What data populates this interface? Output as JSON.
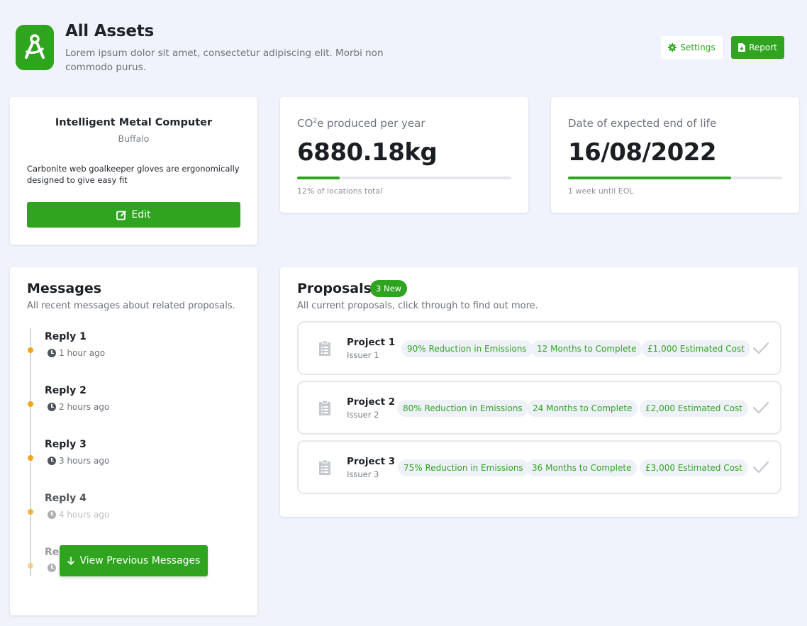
{
  "header": {
    "title": "All Assets",
    "subtitle": "Lorem ipsum dolor sit amet, consectetur adipiscing elit. Morbi non commodo purus.",
    "settings_label": "Settings",
    "report_label": "Report"
  },
  "asset": {
    "name": "Intelligent Metal Computer",
    "location": "Buffalo",
    "description": "Carbonite web goalkeeper gloves are ergonomically designed to give easy fit",
    "edit_label": "Edit"
  },
  "stats": [
    {
      "label_prefix": "CO",
      "label_sup": "2",
      "label_suffix": "e produced per year",
      "value": "6880.18kg",
      "progress": 0.2,
      "note": "12% of locations total"
    },
    {
      "label": "Date of expected end of life",
      "value": "16/08/2022",
      "progress": 0.76,
      "note": "1 week until EOL"
    }
  ],
  "messages": {
    "title": "Messages",
    "subtitle": "All recent messages about related proposals.",
    "items": [
      {
        "title": "Reply 1",
        "time": "1 hour ago"
      },
      {
        "title": "Reply 2",
        "time": "2 hours ago"
      },
      {
        "title": "Reply 3",
        "time": "3 hours ago"
      },
      {
        "title": "Reply 4",
        "time": "4 hours ago"
      },
      {
        "title": "Rep",
        "time": ""
      }
    ],
    "view_previous_label": "View Previous Messages"
  },
  "proposals": {
    "title": "Proposals",
    "new_badge": "3 New",
    "subtitle": "All current proposals, click through to find out more.",
    "items": [
      {
        "name": "Project 1",
        "issuer": "Issuer 1",
        "reduction": "90% Reduction in Emissions",
        "duration": "12 Months to Complete",
        "cost": "£1,000 Estimated Cost"
      },
      {
        "name": "Project 2",
        "issuer": "Issuer 2",
        "reduction": "80% Reduction in Emissions",
        "duration": "24 Months to Complete",
        "cost": "£2,000 Estimated Cost"
      },
      {
        "name": "Project 3",
        "issuer": "Issuer 3",
        "reduction": "75% Reduction in Emissions",
        "duration": "36 Months to Complete",
        "cost": "£3,000 Estimated Cost"
      }
    ]
  },
  "colors": {
    "accent": "#2fa41f",
    "timeline_dot": "#f2a51a",
    "background": "#f0f3fb"
  }
}
